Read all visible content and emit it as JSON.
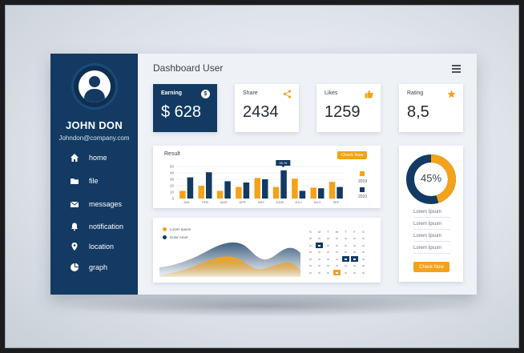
{
  "header": {
    "title": "Dashboard User"
  },
  "user": {
    "name": "JOHN DON",
    "email": "Johndon@company.com"
  },
  "sidebar": {
    "items": [
      {
        "label": "home",
        "icon": "home-icon"
      },
      {
        "label": "file",
        "icon": "folder-icon"
      },
      {
        "label": "messages",
        "icon": "envelope-icon"
      },
      {
        "label": "notification",
        "icon": "bell-icon"
      },
      {
        "label": "location",
        "icon": "location-pin-icon"
      },
      {
        "label": "graph",
        "icon": "pie-chart-icon"
      }
    ]
  },
  "stats": {
    "earning": {
      "label": "Earning",
      "value": "$ 628",
      "badge": "$"
    },
    "share": {
      "label": "Share",
      "value": "2434",
      "icon": "share-icon"
    },
    "likes": {
      "label": "Likes",
      "value": "1259",
      "icon": "thumbs-up-icon"
    },
    "rating": {
      "label": "Rating",
      "value": "8,5",
      "icon": "star-icon"
    }
  },
  "result": {
    "title": "Result",
    "button": "Check Now",
    "tooltip": "28.76",
    "legend": [
      {
        "label": "2019",
        "color": "#f3a21a"
      },
      {
        "label": "2020",
        "color": "#123a63"
      }
    ]
  },
  "chart_data": {
    "type": "bar",
    "categories": [
      "JAN",
      "FEB",
      "MAR",
      "APR",
      "MAY",
      "JUNE",
      "JULY",
      "AUG",
      "SEP"
    ],
    "yticks": [
      0,
      10,
      20,
      30,
      40,
      50
    ],
    "ylim": [
      0,
      50
    ],
    "series": [
      {
        "name": "2019",
        "color": "#f3a21a",
        "values": [
          12,
          20,
          12,
          18,
          32,
          18,
          31,
          17,
          26
        ]
      },
      {
        "name": "2020",
        "color": "#123a63",
        "values": [
          33,
          41,
          27,
          25,
          30,
          44,
          12,
          16,
          18
        ]
      }
    ]
  },
  "wave_chart": {
    "legend": [
      {
        "label": "Lorem Ipsum",
        "color": "#f3a21a"
      },
      {
        "label": "Dolor Amet",
        "color": "#123a63"
      }
    ],
    "calendar_headers": [
      "S",
      "M",
      "T",
      "W",
      "T",
      "F",
      "S"
    ],
    "calendar_rows": [
      [
        "",
        "",
        "",
        "",
        "",
        "",
        ""
      ],
      [
        "",
        "",
        "",
        "",
        "",
        "",
        ""
      ],
      [
        "",
        "",
        "",
        "",
        "",
        "",
        ""
      ],
      [
        "",
        "",
        "",
        "",
        "",
        "",
        ""
      ],
      [
        "",
        "",
        "",
        "",
        "",
        "",
        ""
      ],
      [
        "",
        "",
        "",
        "",
        "",
        "",
        ""
      ]
    ]
  },
  "donut": {
    "percent_label": "45%",
    "percent": 45,
    "items": [
      "Lorem Ipsum",
      "Lorem Ipsum",
      "Lorem Ipsum",
      "Lorem Ipsum"
    ],
    "button": "Check Now"
  }
}
